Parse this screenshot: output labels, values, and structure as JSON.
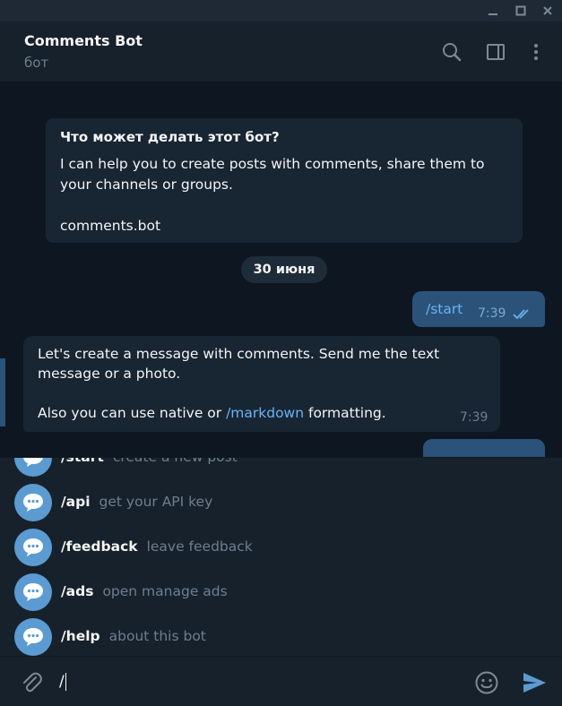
{
  "chat": {
    "title": "Comments Bot",
    "status": "бот"
  },
  "info_card": {
    "title": "Что может делать этот бот?",
    "text": "I can help you to create posts with comments, share them to your channels or groups.\n\ncomments.bot"
  },
  "date_separator": "30 июня",
  "outgoing": {
    "text": "/start",
    "time": "7:39"
  },
  "incoming": {
    "line1": "Let's create a message with comments. Send me the text message or a photo.",
    "pre_link": "Also you can use native or ",
    "link": "/markdown",
    "post_link": " formatting.",
    "time": "7:39"
  },
  "commands": [
    {
      "name": "/start",
      "desc": "create a new post"
    },
    {
      "name": "/api",
      "desc": "get your API key"
    },
    {
      "name": "/feedback",
      "desc": "leave feedback"
    },
    {
      "name": "/ads",
      "desc": "open manage ads"
    },
    {
      "name": "/help",
      "desc": "about this bot"
    }
  ],
  "composer": {
    "value": "/"
  },
  "colors": {
    "accent": "#5b9bd1",
    "link": "#6ab3f3",
    "bubble_out": "#2b5278",
    "bubble_in": "#182533"
  },
  "icons": [
    "minimize-icon",
    "maximize-icon",
    "close-icon",
    "search-icon",
    "sidebar-toggle-icon",
    "more-icon",
    "attach-icon",
    "emoji-icon",
    "send-icon",
    "bot-command-icon",
    "double-check-icon"
  ]
}
